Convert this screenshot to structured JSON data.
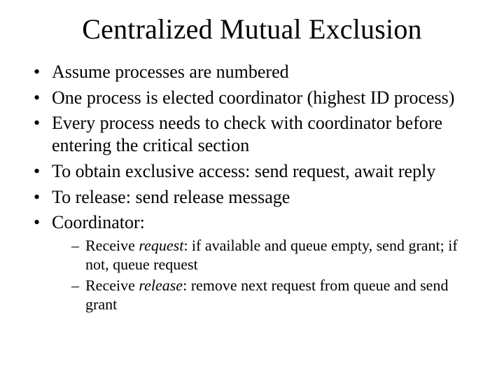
{
  "slide": {
    "title": "Centralized Mutual Exclusion",
    "bullets": [
      {
        "text": "Assume processes are numbered"
      },
      {
        "text": "One process is elected coordinator (highest ID process)"
      },
      {
        "text": "Every process needs to check with coordinator before entering the critical section"
      },
      {
        "text": "To obtain exclusive access: send request, await reply"
      },
      {
        "text": "To release: send release message"
      },
      {
        "text": "Coordinator:",
        "sub": [
          {
            "prefix": "Receive ",
            "emph": "request",
            "suffix": ": if available and queue empty, send grant; if not, queue request"
          },
          {
            "prefix": "Receive ",
            "emph": "release",
            "suffix": ": remove next request from queue and send grant"
          }
        ]
      }
    ]
  }
}
